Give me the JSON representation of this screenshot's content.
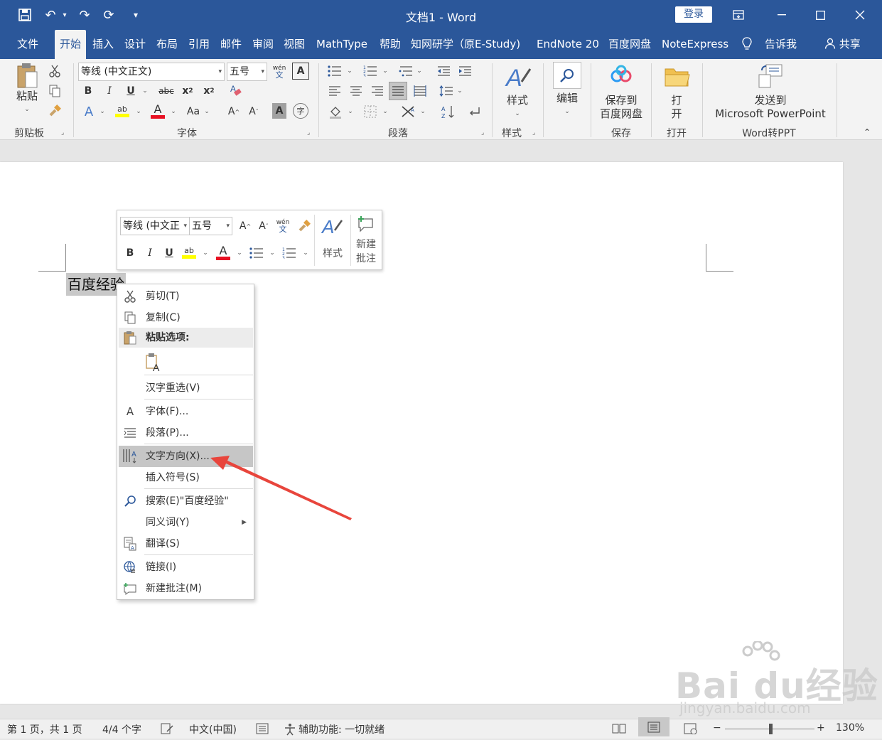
{
  "title_bar": {
    "title": "文档1  -  Word",
    "login_label": "登录",
    "quick_access": [
      "save-icon",
      "undo-icon",
      "redo-icon",
      "refresh-icon",
      "customize-icon"
    ]
  },
  "tabs": [
    "文件",
    "开始",
    "插入",
    "设计",
    "布局",
    "引用",
    "邮件",
    "审阅",
    "视图",
    "MathType",
    "帮助",
    "知网研学（原E-Study)",
    "EndNote 20",
    "百度网盘",
    "NoteExpress",
    "告诉我",
    "共享"
  ],
  "active_tab": "开始",
  "ribbon": {
    "clipboard": {
      "paste_label": "粘贴",
      "group_label": "剪贴板"
    },
    "font": {
      "font_name": "等线 (中文正文)",
      "font_size": "五号",
      "group_label": "字体"
    },
    "paragraph": {
      "group_label": "段落"
    },
    "styles": {
      "styles_label": "样式",
      "group_label": "样式"
    },
    "editing": {
      "label": "编辑"
    },
    "save": {
      "line1": "保存到",
      "line2": "百度网盘",
      "group_label": "保存"
    },
    "open": {
      "line1": "打",
      "line2": "开",
      "group_label": "打开"
    },
    "ppt": {
      "line1": "发送到",
      "line2": "Microsoft PowerPoint",
      "group_label": "Word转PPT"
    }
  },
  "document": {
    "selected_text": "百度经验"
  },
  "mini_toolbar": {
    "font_name": "等线 (中文正",
    "font_size": "五号",
    "styles_label": "样式",
    "new_comment_line1": "新建",
    "new_comment_line2": "批注"
  },
  "context_menu": {
    "items": [
      {
        "label": "剪切(T)",
        "icon": "scissors-icon"
      },
      {
        "label": "复制(C)",
        "icon": "copy-icon"
      },
      {
        "label": "粘贴选项:",
        "icon": "clipboard-icon"
      },
      {
        "label": "汉字重选(V)",
        "icon": ""
      },
      {
        "label": "字体(F)...",
        "icon": "font-icon"
      },
      {
        "label": "段落(P)...",
        "icon": "paragraph-icon"
      },
      {
        "label": "文字方向(X)...",
        "icon": "text-direction-icon"
      },
      {
        "label": "插入符号(S)",
        "icon": ""
      },
      {
        "label": "搜索(E)\"百度经验\"",
        "icon": "search-icon"
      },
      {
        "label": "同义词(Y)",
        "icon": ""
      },
      {
        "label": "翻译(S)",
        "icon": "translate-icon"
      },
      {
        "label": "链接(I)",
        "icon": "link-icon"
      },
      {
        "label": "新建批注(M)",
        "icon": "comment-icon"
      }
    ],
    "highlighted": "文字方向(X)..."
  },
  "status_bar": {
    "page_info": "第 1 页，共 1 页",
    "word_count": "4/4 个字",
    "language": "中文(中国)",
    "accessibility": "辅助功能: 一切就绪",
    "zoom_minus": "−",
    "zoom_plus": "+",
    "zoom": "130%"
  },
  "watermark": {
    "brand": "Bai du经验",
    "url": "jingyan.baidu.com"
  },
  "colors": {
    "title_bar": "#2b579a",
    "ribbon": "#f3f3f3",
    "highlight": "#c6c6c6",
    "arrow": "#e8453c",
    "font_color_bar": "#e81123",
    "highlight_bar": "#ffff00"
  }
}
